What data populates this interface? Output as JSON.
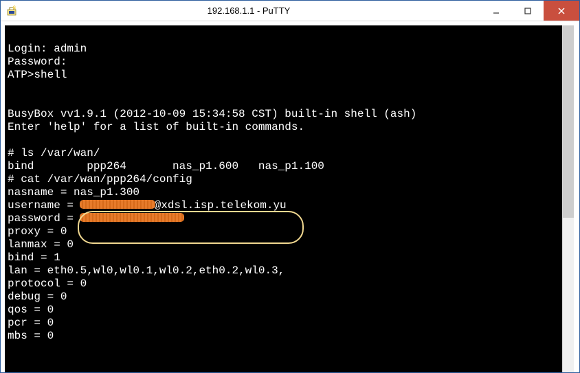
{
  "window": {
    "title": "192.168.1.1 - PuTTY"
  },
  "terminal": {
    "login_label": "Login: ",
    "login_value": "admin",
    "password_label": "Password:",
    "prompt1": "ATP>",
    "prompt1_cmd": "shell",
    "busybox": "BusyBox vv1.9.1 (2012-10-09 15:34:58 CST) built-in shell (ash)",
    "help": "Enter 'help' for a list of built-in commands.",
    "ls_prompt": "# ls /var/wan/",
    "ls_bind": "bind",
    "ls_ppp": "ppp264",
    "ls_nas600": "nas_p1.600",
    "ls_nas100": "nas_p1.100",
    "cat_prompt": "# cat /var/wan/ppp264/config",
    "nasname": "nasname = nas_p1.300",
    "username_label": "username = ",
    "username_suffix": "@xdsl.isp.telekom.yu",
    "passwordline_label": "password = ",
    "proxy": "proxy = 0",
    "lanmax": "lanmax = 0",
    "bindline": "bind = 1",
    "lan": "lan = eth0.5,wl0,wl0.1,wl0.2,eth0.2,wl0.3,",
    "protocol": "protocol = 0",
    "debug": "debug = 0",
    "qos": "qos = 0",
    "pcr": "pcr = 0",
    "mbs": "mbs = 0"
  }
}
